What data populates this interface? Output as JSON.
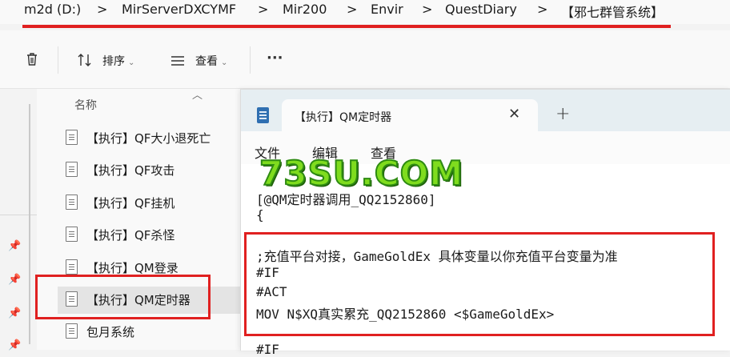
{
  "breadcrumb": {
    "items": [
      "m2d (D:)",
      "MirServerDXCYMF",
      "Mir200",
      "Envir",
      "QuestDiary",
      "【邪七群管系统】"
    ],
    "separator": ">"
  },
  "toolbar": {
    "delete_icon": "trash-icon",
    "sort_label": "排序",
    "view_label": "查看",
    "more_label": "···"
  },
  "file_list": {
    "column_header": "名称",
    "items": [
      {
        "label": "【执行】QF大小退死亡"
      },
      {
        "label": "【执行】QF攻击"
      },
      {
        "label": "【执行】QF挂机"
      },
      {
        "label": "【执行】QF杀怪"
      },
      {
        "label": "【执行】QM登录"
      },
      {
        "label": "【执行】QM定时器",
        "selected": true
      },
      {
        "label": "包月系统"
      }
    ]
  },
  "notepad": {
    "tab_title": "【执行】QM定时器",
    "close_glyph": "✕",
    "new_tab_glyph": "+",
    "menu": [
      "文件",
      "编辑",
      "查看"
    ],
    "code_lines": [
      "[@QM定时器调用_QQ2152860]",
      "{",
      ";充值平台对接，GameGoldEx 具体变量以你充值平台变量为准",
      "#IF",
      "#ACT",
      "MOV N$XQ真实累充_QQ2152860 <$GameGoldEx>",
      "#IF"
    ]
  },
  "watermark": "73SU.COM",
  "colors": {
    "highlight_red": "#e02020",
    "watermark_green": "#7fdc1e"
  }
}
